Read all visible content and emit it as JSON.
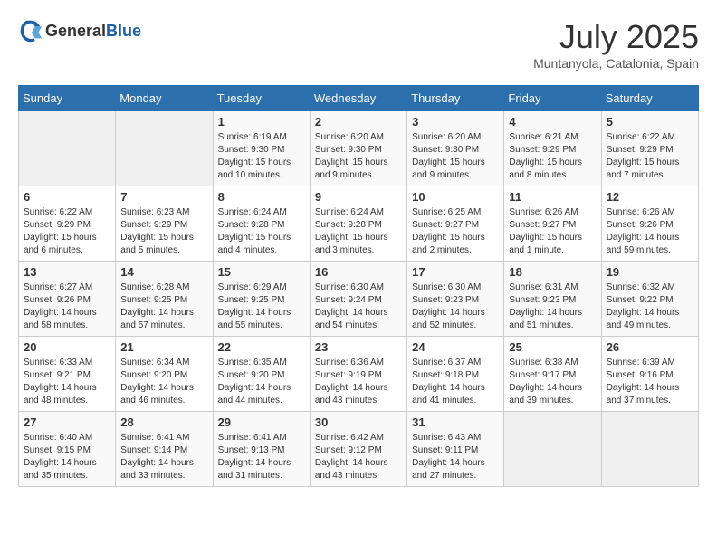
{
  "logo": {
    "general": "General",
    "blue": "Blue"
  },
  "title": "July 2025",
  "location": "Muntanyola, Catalonia, Spain",
  "days_of_week": [
    "Sunday",
    "Monday",
    "Tuesday",
    "Wednesday",
    "Thursday",
    "Friday",
    "Saturday"
  ],
  "weeks": [
    [
      {
        "day": "",
        "info": ""
      },
      {
        "day": "",
        "info": ""
      },
      {
        "day": "1",
        "info": "Sunrise: 6:19 AM\nSunset: 9:30 PM\nDaylight: 15 hours and 10 minutes."
      },
      {
        "day": "2",
        "info": "Sunrise: 6:20 AM\nSunset: 9:30 PM\nDaylight: 15 hours and 9 minutes."
      },
      {
        "day": "3",
        "info": "Sunrise: 6:20 AM\nSunset: 9:30 PM\nDaylight: 15 hours and 9 minutes."
      },
      {
        "day": "4",
        "info": "Sunrise: 6:21 AM\nSunset: 9:29 PM\nDaylight: 15 hours and 8 minutes."
      },
      {
        "day": "5",
        "info": "Sunrise: 6:22 AM\nSunset: 9:29 PM\nDaylight: 15 hours and 7 minutes."
      }
    ],
    [
      {
        "day": "6",
        "info": "Sunrise: 6:22 AM\nSunset: 9:29 PM\nDaylight: 15 hours and 6 minutes."
      },
      {
        "day": "7",
        "info": "Sunrise: 6:23 AM\nSunset: 9:29 PM\nDaylight: 15 hours and 5 minutes."
      },
      {
        "day": "8",
        "info": "Sunrise: 6:24 AM\nSunset: 9:28 PM\nDaylight: 15 hours and 4 minutes."
      },
      {
        "day": "9",
        "info": "Sunrise: 6:24 AM\nSunset: 9:28 PM\nDaylight: 15 hours and 3 minutes."
      },
      {
        "day": "10",
        "info": "Sunrise: 6:25 AM\nSunset: 9:27 PM\nDaylight: 15 hours and 2 minutes."
      },
      {
        "day": "11",
        "info": "Sunrise: 6:26 AM\nSunset: 9:27 PM\nDaylight: 15 hours and 1 minute."
      },
      {
        "day": "12",
        "info": "Sunrise: 6:26 AM\nSunset: 9:26 PM\nDaylight: 14 hours and 59 minutes."
      }
    ],
    [
      {
        "day": "13",
        "info": "Sunrise: 6:27 AM\nSunset: 9:26 PM\nDaylight: 14 hours and 58 minutes."
      },
      {
        "day": "14",
        "info": "Sunrise: 6:28 AM\nSunset: 9:25 PM\nDaylight: 14 hours and 57 minutes."
      },
      {
        "day": "15",
        "info": "Sunrise: 6:29 AM\nSunset: 9:25 PM\nDaylight: 14 hours and 55 minutes."
      },
      {
        "day": "16",
        "info": "Sunrise: 6:30 AM\nSunset: 9:24 PM\nDaylight: 14 hours and 54 minutes."
      },
      {
        "day": "17",
        "info": "Sunrise: 6:30 AM\nSunset: 9:23 PM\nDaylight: 14 hours and 52 minutes."
      },
      {
        "day": "18",
        "info": "Sunrise: 6:31 AM\nSunset: 9:23 PM\nDaylight: 14 hours and 51 minutes."
      },
      {
        "day": "19",
        "info": "Sunrise: 6:32 AM\nSunset: 9:22 PM\nDaylight: 14 hours and 49 minutes."
      }
    ],
    [
      {
        "day": "20",
        "info": "Sunrise: 6:33 AM\nSunset: 9:21 PM\nDaylight: 14 hours and 48 minutes."
      },
      {
        "day": "21",
        "info": "Sunrise: 6:34 AM\nSunset: 9:20 PM\nDaylight: 14 hours and 46 minutes."
      },
      {
        "day": "22",
        "info": "Sunrise: 6:35 AM\nSunset: 9:20 PM\nDaylight: 14 hours and 44 minutes."
      },
      {
        "day": "23",
        "info": "Sunrise: 6:36 AM\nSunset: 9:19 PM\nDaylight: 14 hours and 43 minutes."
      },
      {
        "day": "24",
        "info": "Sunrise: 6:37 AM\nSunset: 9:18 PM\nDaylight: 14 hours and 41 minutes."
      },
      {
        "day": "25",
        "info": "Sunrise: 6:38 AM\nSunset: 9:17 PM\nDaylight: 14 hours and 39 minutes."
      },
      {
        "day": "26",
        "info": "Sunrise: 6:39 AM\nSunset: 9:16 PM\nDaylight: 14 hours and 37 minutes."
      }
    ],
    [
      {
        "day": "27",
        "info": "Sunrise: 6:40 AM\nSunset: 9:15 PM\nDaylight: 14 hours and 35 minutes."
      },
      {
        "day": "28",
        "info": "Sunrise: 6:41 AM\nSunset: 9:14 PM\nDaylight: 14 hours and 33 minutes."
      },
      {
        "day": "29",
        "info": "Sunrise: 6:41 AM\nSunset: 9:13 PM\nDaylight: 14 hours and 31 minutes."
      },
      {
        "day": "30",
        "info": "Sunrise: 6:42 AM\nSunset: 9:12 PM\nDaylight: 14 hours and 43 minutes."
      },
      {
        "day": "31",
        "info": "Sunrise: 6:43 AM\nSunset: 9:11 PM\nDaylight: 14 hours and 27 minutes."
      },
      {
        "day": "",
        "info": ""
      },
      {
        "day": "",
        "info": ""
      }
    ]
  ]
}
